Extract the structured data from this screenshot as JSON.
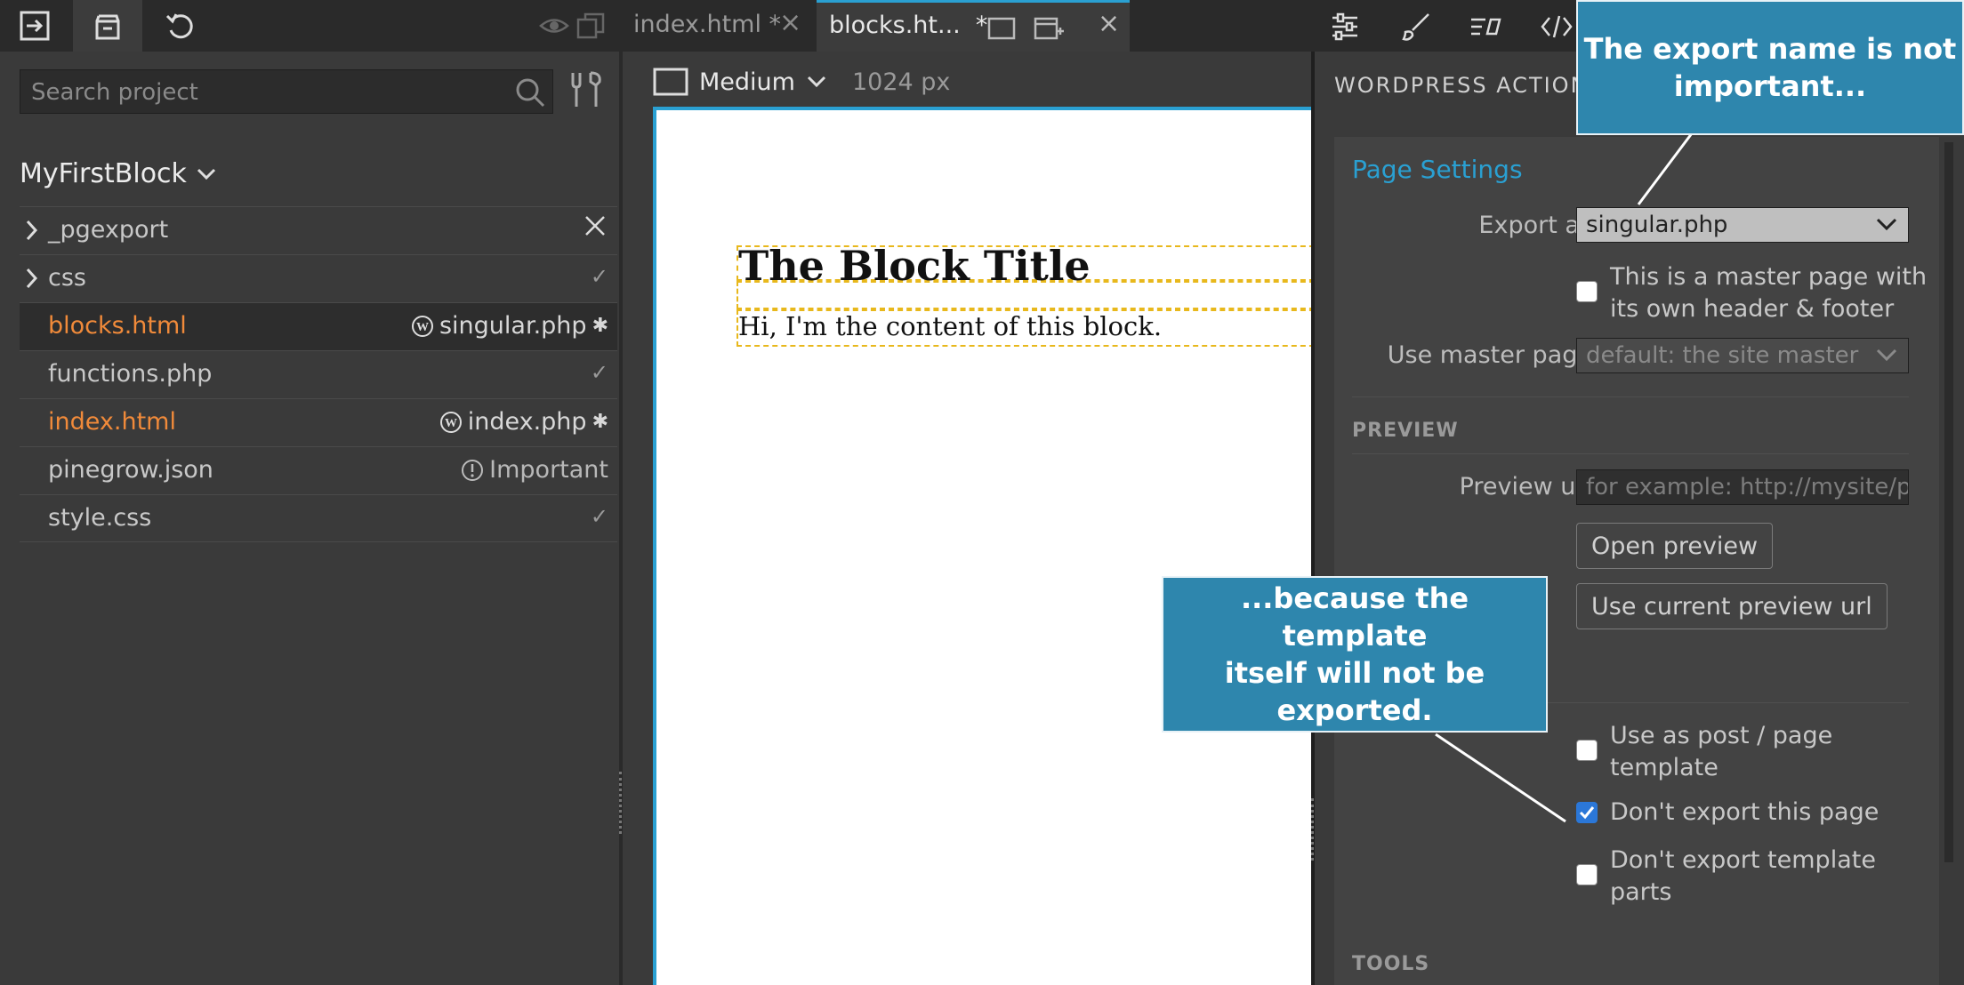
{
  "topbar": {
    "tabs": [
      {
        "label": "index.html *"
      },
      {
        "label": "blocks.ht...  *"
      }
    ]
  },
  "left": {
    "search_placeholder": "Search project",
    "project_name": "MyFirstBlock",
    "files": [
      {
        "name": "_pgexport",
        "status": ""
      },
      {
        "name": "css",
        "status": "✓"
      },
      {
        "name": "blocks.html",
        "status": "singular.php"
      },
      {
        "name": "functions.php",
        "status": "✓"
      },
      {
        "name": "index.html",
        "status": "index.php"
      },
      {
        "name": "pinegrow.json",
        "status": "Important"
      },
      {
        "name": "style.css",
        "status": "✓"
      }
    ]
  },
  "center": {
    "device_label": "Medium",
    "width_label": "1024 px",
    "block_title": "The Block Title",
    "block_body": "Hi, I'm the content of this block."
  },
  "right": {
    "heading": "WORDPRESS ACTIONS",
    "section_title": "Page Settings",
    "export_as_label": "Export as",
    "export_as_value": "singular.php",
    "master_checkbox_label_1": "This is a master page with",
    "master_checkbox_label_2": "its own header & footer",
    "use_master_label": "Use master page",
    "use_master_value": "default: the site master",
    "preview_heading": "PREVIEW",
    "preview_url_label": "Preview url",
    "preview_url_placeholder": "for example: http://mysite/pag",
    "open_preview": "Open preview",
    "use_current_preview": "Use current preview url",
    "template_label_1": "Use as post / page",
    "template_label_2": "template",
    "dont_export_label": "Don't export this page",
    "dont_export_parts_1": "Don't export template",
    "dont_export_parts_2": "parts",
    "tools_heading": "TOOLS"
  },
  "callouts": {
    "top_1": "The export name is not",
    "top_2": "important...",
    "mid_1": "...because the template",
    "mid_2": "itself will not be exported."
  }
}
